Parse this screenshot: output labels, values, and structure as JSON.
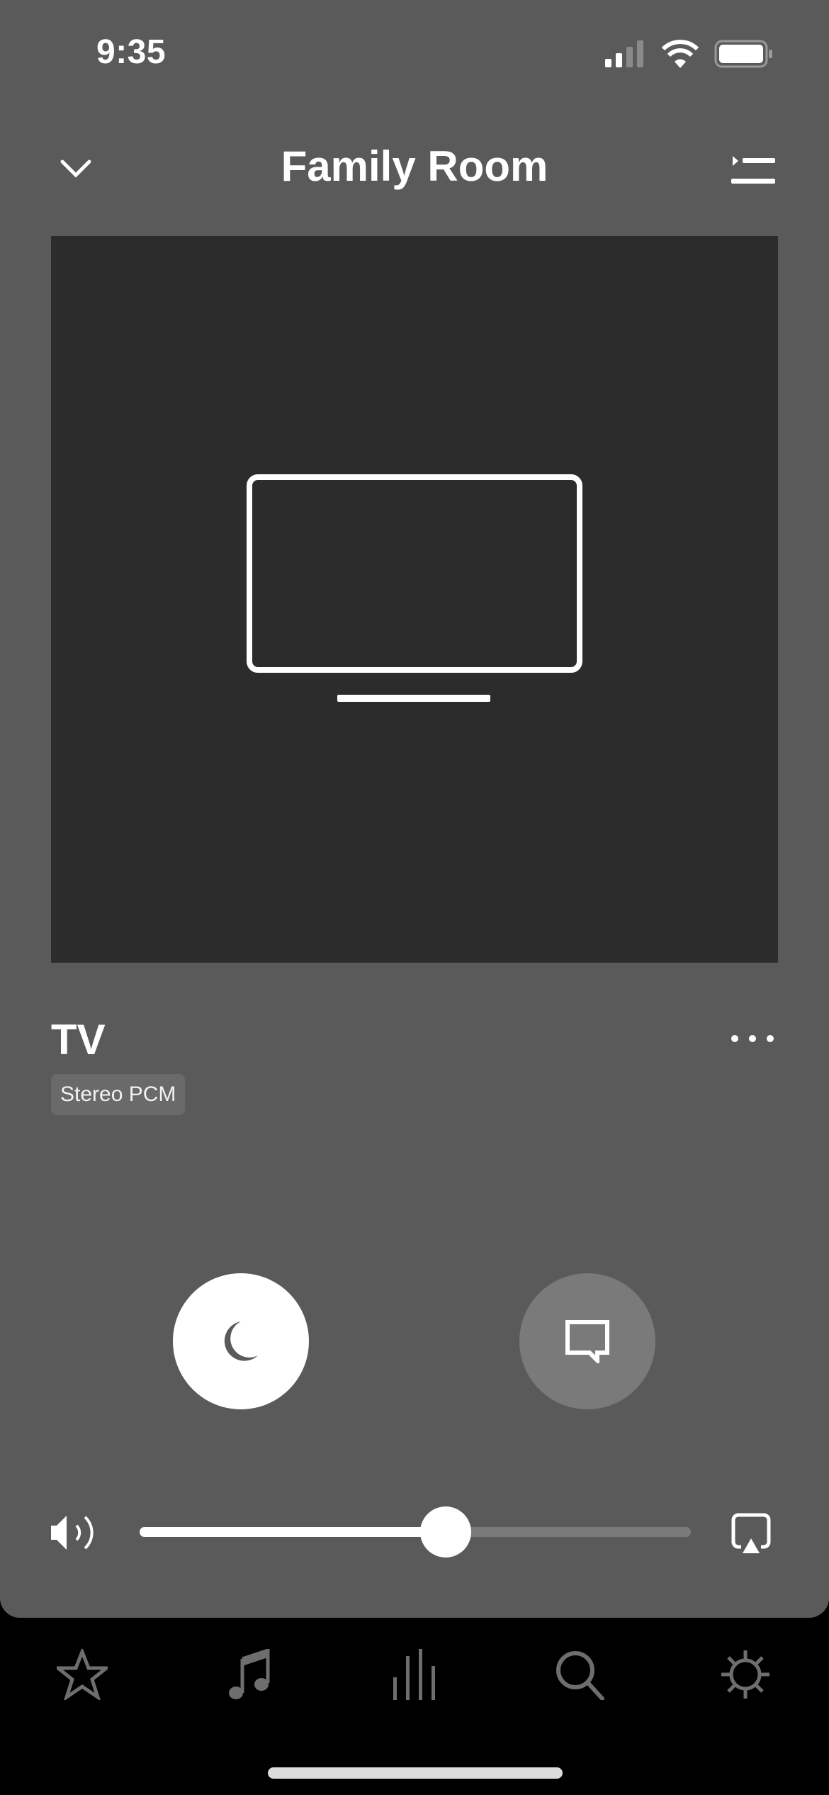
{
  "status_bar": {
    "time": "9:35",
    "signal_bars_active": 2,
    "signal_bars_total": 4,
    "icons": [
      "cellular-signal-icon",
      "wifi-icon",
      "battery-icon"
    ]
  },
  "header": {
    "title": "Family Room",
    "left_icon": "chevron-down-icon",
    "right_icon": "queue-icon"
  },
  "now_playing": {
    "artwork_icon": "tv-icon",
    "title": "TV",
    "badge": "Stereo PCM",
    "more_icon": "more-dots-icon"
  },
  "controls": {
    "sleep_button": {
      "icon": "moon-icon",
      "active": true
    },
    "speech_button": {
      "icon": "speech-bubble-icon",
      "active": false
    }
  },
  "volume": {
    "level_fraction": 0.555,
    "speaker_icon": "speaker-icon",
    "output_icon": "airplay-icon"
  },
  "tab_bar": {
    "tabs": [
      {
        "name": "favorites",
        "icon": "star-icon"
      },
      {
        "name": "music",
        "icon": "music-note-icon"
      },
      {
        "name": "rooms",
        "icon": "bars-icon"
      },
      {
        "name": "search",
        "icon": "search-icon"
      },
      {
        "name": "settings",
        "icon": "gear-icon"
      }
    ]
  },
  "colors": {
    "panel": "#5a5a5a",
    "artwork_bg": "#2c2c2c",
    "tab_icon": "#6e6e6e",
    "track_inactive": "#7a7a7a"
  }
}
